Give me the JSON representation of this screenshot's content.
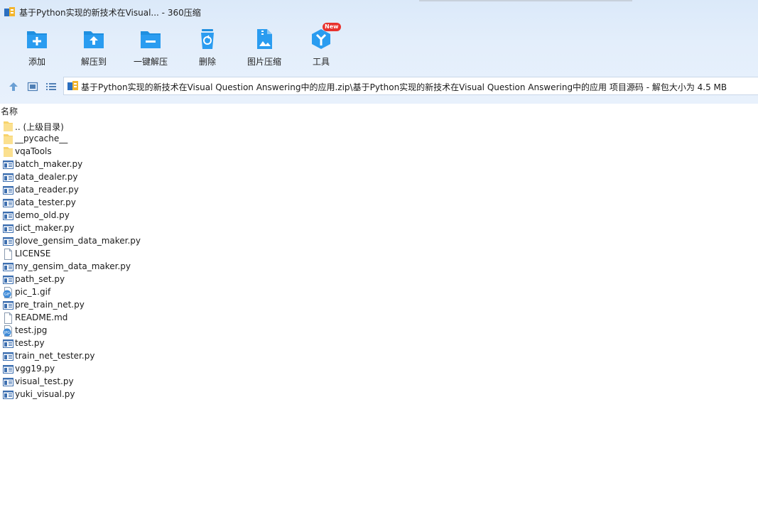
{
  "window": {
    "title": "基于Python实现的新技术在Visual... - 360压缩"
  },
  "toolbar": {
    "items": [
      {
        "label": "添加",
        "icon": "add-file-icon"
      },
      {
        "label": "解压到",
        "icon": "extract-to-icon"
      },
      {
        "label": "一键解压",
        "icon": "one-click-extract-icon"
      },
      {
        "label": "删除",
        "icon": "delete-icon"
      },
      {
        "label": "图片压缩",
        "icon": "image-compress-icon"
      },
      {
        "label": "工具",
        "icon": "tools-icon"
      }
    ],
    "new_badge": "New"
  },
  "navbar": {
    "path": "基于Python实现的新技术在Visual Question Answering中的应用.zip\\基于Python实现的新技术在Visual Question Answering中的应用 项目源码 - 解包大小为 4.5 MB"
  },
  "list": {
    "header_name": "名称",
    "files": [
      {
        "name": ".. (上级目录)",
        "type": "folder"
      },
      {
        "name": "__pycache__",
        "type": "folder"
      },
      {
        "name": "vqaTools",
        "type": "folder"
      },
      {
        "name": "batch_maker.py",
        "type": "py"
      },
      {
        "name": "data_dealer.py",
        "type": "py"
      },
      {
        "name": "data_reader.py",
        "type": "py"
      },
      {
        "name": "data_tester.py",
        "type": "py"
      },
      {
        "name": "demo_old.py",
        "type": "py"
      },
      {
        "name": "dict_maker.py",
        "type": "py"
      },
      {
        "name": "glove_gensim_data_maker.py",
        "type": "py"
      },
      {
        "name": "LICENSE",
        "type": "file"
      },
      {
        "name": "my_gensim_data_maker.py",
        "type": "py"
      },
      {
        "name": "path_set.py",
        "type": "py"
      },
      {
        "name": "pic_1.gif",
        "type": "gif"
      },
      {
        "name": "pre_train_net.py",
        "type": "py"
      },
      {
        "name": "README.md",
        "type": "file"
      },
      {
        "name": "test.jpg",
        "type": "jpg"
      },
      {
        "name": "test.py",
        "type": "py"
      },
      {
        "name": "train_net_tester.py",
        "type": "py"
      },
      {
        "name": "vgg19.py",
        "type": "py"
      },
      {
        "name": "visual_test.py",
        "type": "py"
      },
      {
        "name": "yuki_visual.py",
        "type": "py"
      }
    ]
  },
  "colors": {
    "toolbar_icon_blue": "#1e8fe0",
    "folder_yellow": "#f7d36b",
    "badge_red": "#e8322d"
  }
}
